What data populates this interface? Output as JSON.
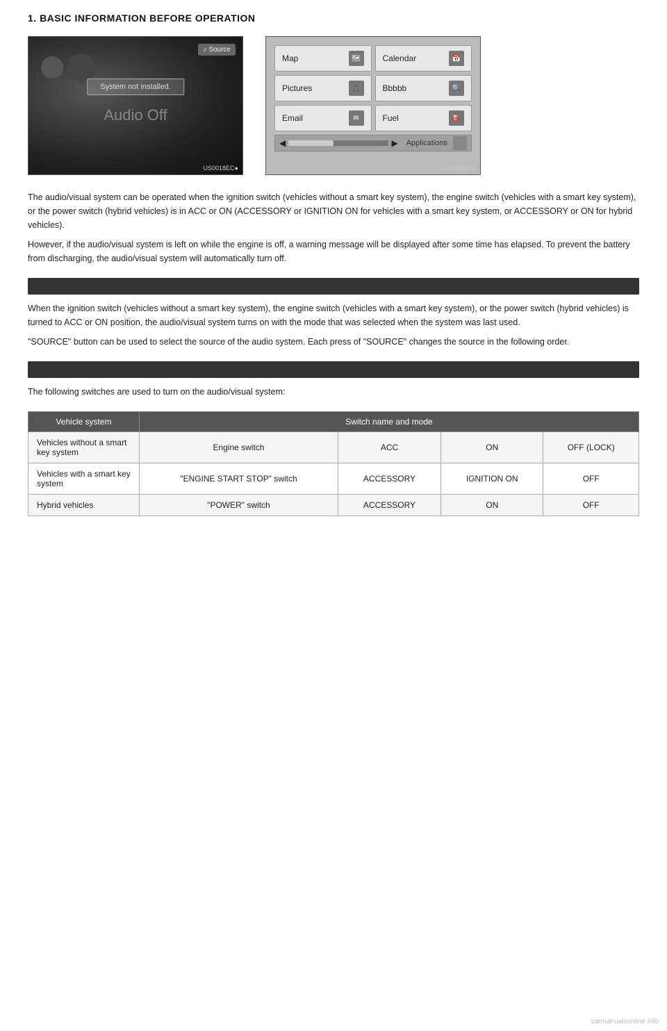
{
  "page": {
    "title": "1. BASIC INFORMATION BEFORE OPERATION"
  },
  "screenshots": {
    "left": {
      "source_btn": "Source",
      "system_msg": "System not installed.",
      "audio_off": "Audio Off",
      "label": "US0018EC●"
    },
    "right": {
      "label": "US3098EC",
      "apps": [
        {
          "name": "Map"
        },
        {
          "name": "Calendar"
        },
        {
          "name": "Pictures"
        },
        {
          "name": "Bbbbb"
        },
        {
          "name": "Email"
        },
        {
          "name": "Fuel"
        }
      ],
      "bottom_bar": "Applications"
    }
  },
  "section1": {
    "header": "",
    "paragraphs": [
      "The audio/visual system can be operated when the ignition switch (vehicles without a smart key system), the engine switch (vehicles with a smart key system), or the power switch (hybrid vehicles) is in ACC or ON (ACCESSORY or IGNITION ON for vehicles with a smart key system, or ACCESSORY or ON for hybrid vehicles).",
      "However, if the audio/visual system is left on while the engine is off, a warning message will be displayed after some time has elapsed. To prevent the battery from discharging, the audio/visual system will automatically turn off."
    ]
  },
  "section2": {
    "header": "",
    "paragraphs": [
      "The following switches are used to turn on the audio/visual system:"
    ]
  },
  "table": {
    "headers": [
      "Vehicle system",
      "Switch name and mode"
    ],
    "sub_headers": [
      "",
      "",
      "ACC / ACCESSORY",
      "ON / IGNITION ON",
      "OFF (LOCK) / OFF"
    ],
    "rows": [
      {
        "vehicle": "Vehicles without a smart key system",
        "switch": "Engine switch",
        "col1": "ACC",
        "col2": "ON",
        "col3": "OFF (LOCK)"
      },
      {
        "vehicle": "Vehicles with a smart key system",
        "switch": "\"ENGINE START STOP\" switch",
        "col1": "ACCESSORY",
        "col2": "IGNITION ON",
        "col3": "OFF"
      },
      {
        "vehicle": "Hybrid vehicles",
        "switch": "\"POWER\" switch",
        "col1": "ACCESSORY",
        "col2": "ON",
        "col3": "OFF"
      }
    ]
  },
  "footer": {
    "watermark": "carmanualsonline.info"
  }
}
